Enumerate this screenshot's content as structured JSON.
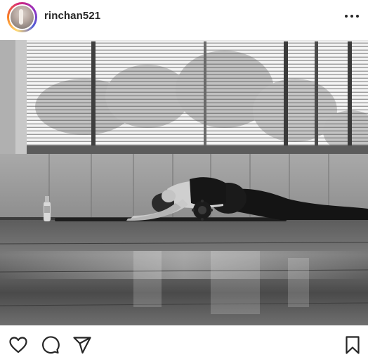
{
  "post": {
    "username": "rinchan521",
    "avatar_icon": "profile-avatar",
    "more_icon": "more-horizontal-icon",
    "photo_description_icon": "yoga-studio-photo"
  },
  "actions": {
    "like_icon": "heart-icon",
    "comment_icon": "comment-icon",
    "share_icon": "send-icon",
    "save_icon": "bookmark-icon"
  },
  "colors": {
    "text": "#262626",
    "ring": [
      "#feda75",
      "#fa7e1e",
      "#d62976",
      "#962fbf",
      "#4f5bd5"
    ]
  }
}
